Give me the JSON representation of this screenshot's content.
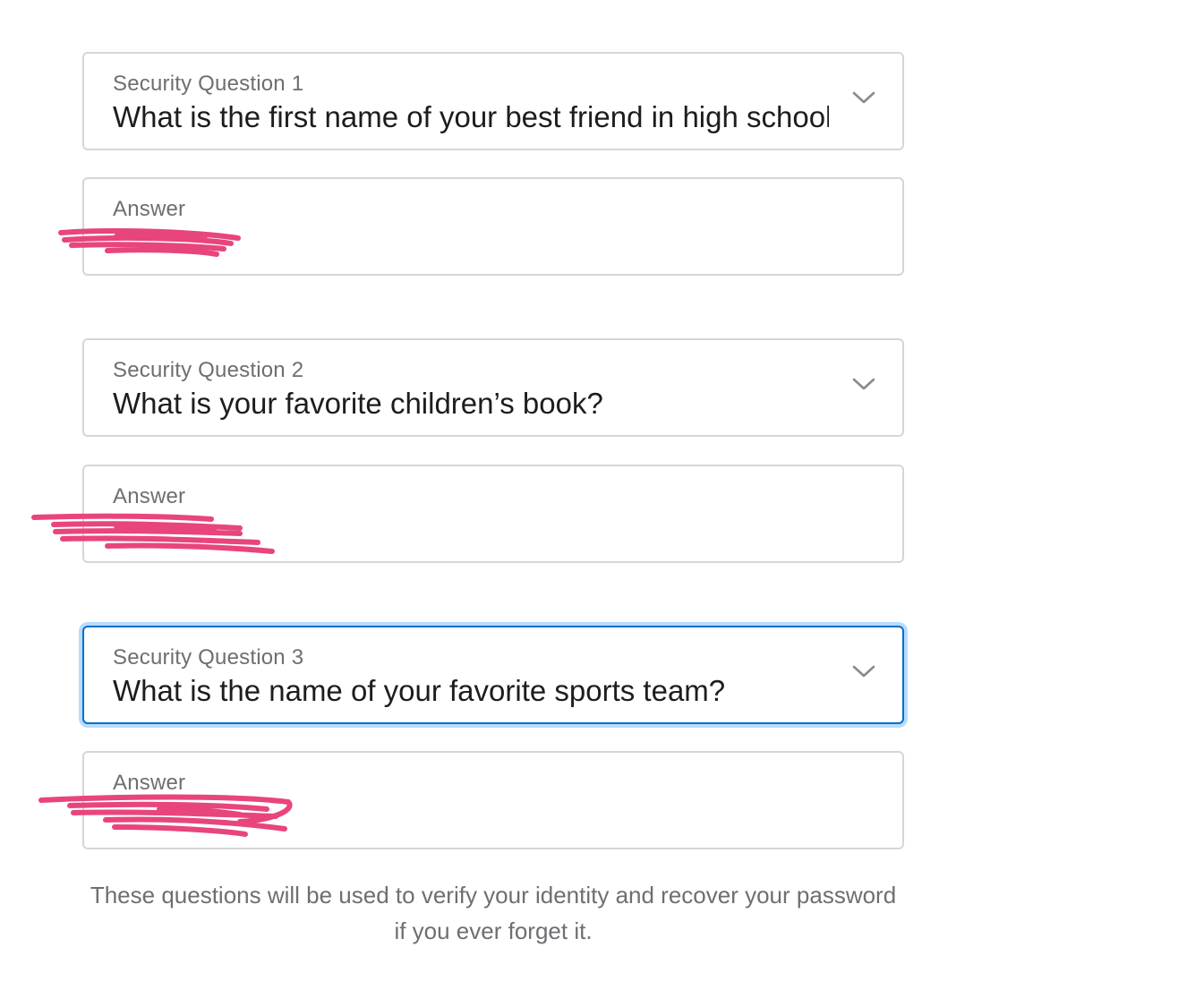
{
  "questions": [
    {
      "label": "Security Question 1",
      "value": "What is the first name of your best friend in high school?",
      "answer_label": "Answer",
      "answer_value": "",
      "focused": false
    },
    {
      "label": "Security Question 2",
      "value": "What is your favorite children’s book?",
      "answer_label": "Answer",
      "answer_value": "",
      "focused": false
    },
    {
      "label": "Security Question 3",
      "value": "What is the name of your favorite sports team?",
      "answer_label": "Answer",
      "answer_value": "",
      "focused": true
    }
  ],
  "footnote": "These questions will be used to verify your identity and recover your password if you ever forget it.",
  "icons": {
    "dropdown": "chevron-down-icon"
  },
  "colors": {
    "focus_border": "#0070c9",
    "redaction": "#e8457c",
    "field_border": "#d6d6d6",
    "label_text": "#6e6e73"
  }
}
